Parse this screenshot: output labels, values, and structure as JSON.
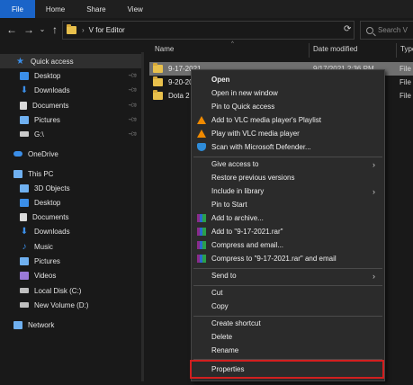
{
  "ribbon": {
    "tabs": [
      {
        "label": "File",
        "active": true
      },
      {
        "label": "Home",
        "active": false
      },
      {
        "label": "Share",
        "active": false
      },
      {
        "label": "View",
        "active": false
      }
    ]
  },
  "address": {
    "path_label": "V for Editor",
    "search_placeholder": "Search V"
  },
  "columns": {
    "name": "Name",
    "date_modified": "Date modified",
    "type": "Type"
  },
  "sidebar": {
    "items": [
      {
        "label": "Quick access",
        "icon": "star-icon",
        "color": "#3b8ee8",
        "pinned": false
      },
      {
        "label": "Desktop",
        "icon": "desktop-icon",
        "color": "#3b8ee8",
        "pinned": true
      },
      {
        "label": "Downloads",
        "icon": "downloads-icon",
        "color": "#3b8ee8",
        "pinned": true
      },
      {
        "label": "Documents",
        "icon": "documents-icon",
        "color": "#d9d9d9",
        "pinned": true
      },
      {
        "label": "Pictures",
        "icon": "pictures-icon",
        "color": "#6fb0f0",
        "pinned": true
      },
      {
        "label": "G:\\",
        "icon": "drive-icon",
        "color": "#c9c9c9",
        "pinned": true
      },
      {
        "label": "OneDrive",
        "icon": "onedrive-icon",
        "color": "#3b8ee8",
        "pinned": false
      },
      {
        "label": "This PC",
        "icon": "pc-icon",
        "color": "#6fb0f0",
        "pinned": false
      },
      {
        "label": "3D Objects",
        "icon": "3d-objects-icon",
        "color": "#6fb0f0",
        "pinned": false
      },
      {
        "label": "Desktop",
        "icon": "desktop-icon",
        "color": "#3b8ee8",
        "pinned": false
      },
      {
        "label": "Documents",
        "icon": "documents-icon",
        "color": "#d9d9d9",
        "pinned": false
      },
      {
        "label": "Downloads",
        "icon": "downloads-icon",
        "color": "#3b8ee8",
        "pinned": false
      },
      {
        "label": "Music",
        "icon": "music-icon",
        "color": "#3b8ee8",
        "pinned": false
      },
      {
        "label": "Pictures",
        "icon": "pictures-icon",
        "color": "#6fb0f0",
        "pinned": false
      },
      {
        "label": "Videos",
        "icon": "videos-icon",
        "color": "#9a7ad8",
        "pinned": false
      },
      {
        "label": "Local Disk (C:)",
        "icon": "local-disk-icon",
        "color": "#bfbfbf",
        "pinned": false
      },
      {
        "label": "New Volume (D:)",
        "icon": "drive-icon",
        "color": "#bfbfbf",
        "pinned": false
      },
      {
        "label": "Network",
        "icon": "network-icon",
        "color": "#6fb0f0",
        "pinned": false
      }
    ]
  },
  "files": [
    {
      "name": "9-17-2021",
      "date": "9/17/2021 2:36 PM",
      "type": "File",
      "selected": true
    },
    {
      "name": "9-20-20",
      "date": "",
      "type": "File",
      "selected": false
    },
    {
      "name": "Dota 2",
      "date": "",
      "type": "File",
      "selected": false
    }
  ],
  "context_menu": {
    "items": [
      {
        "label": "Open",
        "bold": true
      },
      {
        "label": "Open in new window"
      },
      {
        "label": "Pin to Quick access"
      },
      {
        "label": "Add to VLC media player's Playlist",
        "icon": "vlc-icon"
      },
      {
        "label": "Play with VLC media player",
        "icon": "vlc-icon"
      },
      {
        "label": "Scan with Microsoft Defender...",
        "icon": "defender-shield-icon"
      },
      {
        "label": "Give access to",
        "submenu": true
      },
      {
        "label": "Restore previous versions"
      },
      {
        "label": "Include in library",
        "submenu": true
      },
      {
        "label": "Pin to Start"
      },
      {
        "label": "Add to archive...",
        "icon": "winrar-icon"
      },
      {
        "label": "Add to \"9-17-2021.rar\"",
        "icon": "winrar-icon"
      },
      {
        "label": "Compress and email...",
        "icon": "winrar-icon"
      },
      {
        "label": "Compress to \"9-17-2021.rar\" and email",
        "icon": "winrar-icon"
      },
      {
        "label": "Send to",
        "submenu": true
      },
      {
        "label": "Cut"
      },
      {
        "label": "Copy"
      },
      {
        "label": "Create shortcut"
      },
      {
        "label": "Delete"
      },
      {
        "label": "Rename"
      },
      {
        "label": "Properties",
        "highlighted": true
      }
    ]
  },
  "colors": {
    "accent": "#1a64c8",
    "highlight_border": "#d11f1f",
    "folder": "#e8c04c"
  }
}
